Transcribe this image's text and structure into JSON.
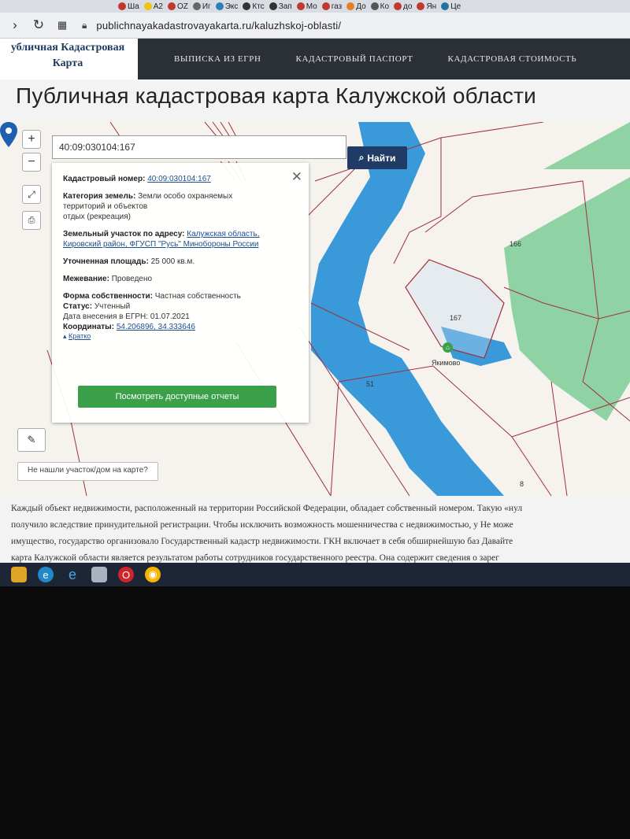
{
  "browser": {
    "bookmarks": [
      "Ша",
      "А2",
      "OZ",
      "Иг",
      "Экс",
      "Ктс",
      "Зап",
      "Мо",
      "газ",
      "До",
      "Ко",
      "до",
      "Ян",
      "Це"
    ],
    "url": "publichnayakadastrovayakarta.ru/kaluzhskoj-oblasti/"
  },
  "header": {
    "logo_line1": "убличная Кадастровая",
    "logo_line2": "Карта",
    "nav": [
      "ВЫПИСКА ИЗ ЕГРН",
      "КАДАСТРОВЫЙ ПАСПОРТ",
      "КАДАСТРОВАЯ СТОИМОСТЬ"
    ]
  },
  "page_title": "Публичная кадастровая карта Калужской области",
  "search": {
    "value": "40:09:030104:167",
    "button": "Найти"
  },
  "map_controls": {
    "zoom_in": "+",
    "zoom_out": "−"
  },
  "popup": {
    "cadastral_label": "Кадастровый номер:",
    "cadastral_value": "40:09:030104:167",
    "category_label": "Категория земель:",
    "category_value_1": "Земли особо охраняемых",
    "category_value_2": "территорий и объектов",
    "category_value_3": "отдых (рекреация)",
    "address_label": "Земельный участок по адресу:",
    "address_value_1": "Калужская область,",
    "address_value_2": "Кировский район, ФГУСП \"Русь\" Минобороны России",
    "area_label": "Уточненная площадь:",
    "area_value": "25 000 кв.м.",
    "survey_label": "Межевание:",
    "survey_value": "Проведено",
    "ownership_label": "Форма собственности:",
    "ownership_value": "Частная собственность",
    "status_label": "Статус:",
    "status_value": "Учтенный",
    "date_label": "Дата внесения в ЕГРН:",
    "date_value": "01.07.2021",
    "coords_label": "Координаты:",
    "coords_value": "54.206896, 34.333646",
    "short_link": "Кратко",
    "reports_button": "Посмотреть доступные отчеты"
  },
  "map_labels": {
    "l166": "166",
    "l167": "167",
    "l51": "51",
    "l8": "8",
    "place": "Якимово"
  },
  "not_found": "Не нашли участок/дом на карте?",
  "body_text": [
    "Каждый объект недвижимости, расположенный на территории Российской Федерации, обладает собственный номером. Такую «нул",
    "получило вследствие принудительной регистрации. Чтобы исключить возможность мошенничества с недвижимостью, у   Не може",
    "имущество, государство организовало Государственный кадастр недвижимости. ГКН включает в себя обширнейшую баз    Давайте",
    "карта Калужской области является результатом работы сотрудников государственного реестра. Она содержит сведения о зарег"
  ],
  "colors": {
    "river": "#3a9ad9",
    "forest": "#8fd3a4",
    "boundary": "#a0303a",
    "nav_bg": "#2b2f36",
    "search_btn": "#1f3b66",
    "reports_btn": "#3aa14a"
  }
}
